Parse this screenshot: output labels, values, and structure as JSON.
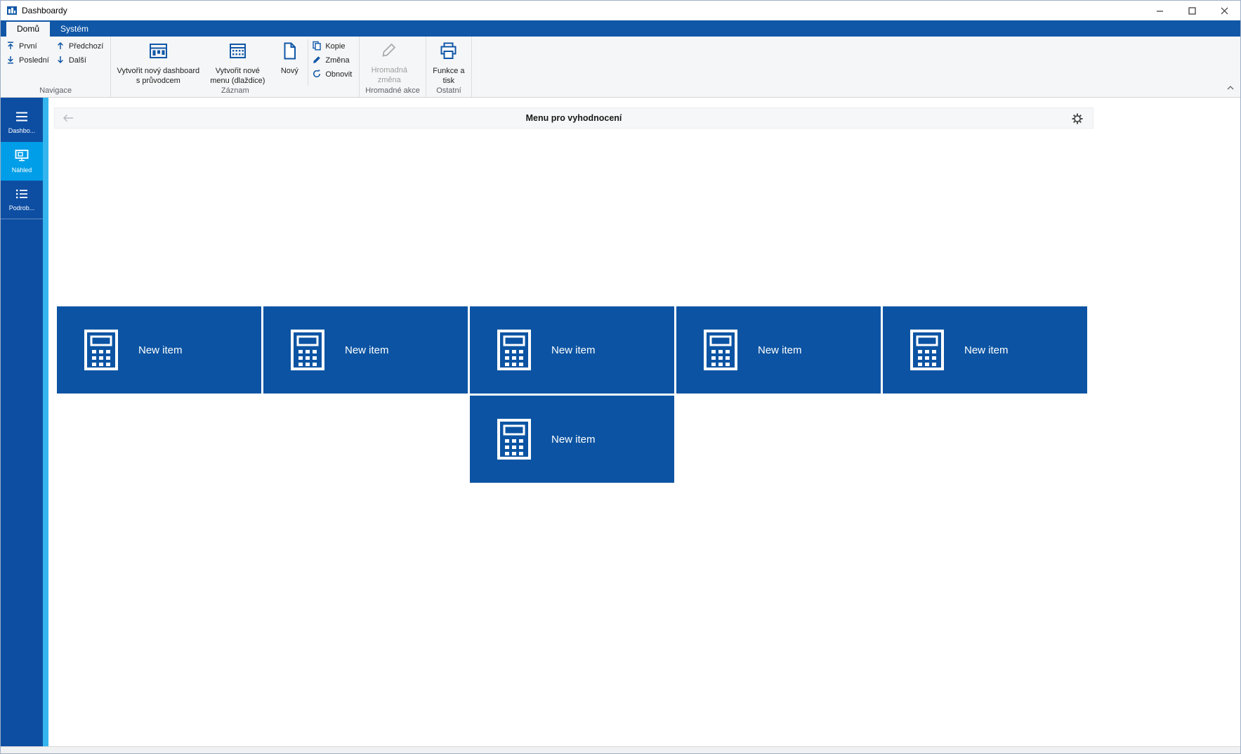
{
  "window": {
    "title": "Dashboardy"
  },
  "tabs": [
    {
      "label": "Domů",
      "active": true
    },
    {
      "label": "Systém",
      "active": false
    }
  ],
  "ribbon": {
    "groups": {
      "navigace": {
        "label": "Navigace"
      },
      "zaznam": {
        "label": "Záznam"
      },
      "hromadne_akce": {
        "label": "Hromadné akce"
      },
      "ostatni": {
        "label": "Ostatní"
      }
    },
    "buttons": {
      "prvni": "První",
      "posledni": "Poslední",
      "predchozi": "Předchozí",
      "dalsi": "Další",
      "vytvorit_dashboard": "Vytvořit nový dashboard s průvodcem",
      "vytvorit_menu": "Vytvořit nové menu (dlaždice)",
      "novy": "Nový",
      "kopie": "Kopie",
      "zmena": "Změna",
      "obnovit": "Obnovit",
      "hromadna_zmena": "Hromadná změna",
      "funkce_a_tisk": "Funkce a tisk"
    }
  },
  "sidebar": {
    "items": [
      {
        "label": "Dashbo...",
        "icon": "menu-icon",
        "active": false
      },
      {
        "label": "Náhled",
        "icon": "preview-monitor-icon",
        "active": true
      },
      {
        "label": "Podrob...",
        "icon": "detail-list-icon",
        "active": false
      }
    ]
  },
  "content": {
    "title": "Menu pro vyhodnocení",
    "tiles": [
      {
        "label": "New item",
        "icon": "calculator-icon"
      },
      {
        "label": "New item",
        "icon": "calculator-icon"
      },
      {
        "label": "New item",
        "icon": "calculator-icon"
      },
      {
        "label": "New item",
        "icon": "calculator-icon"
      },
      {
        "label": "New item",
        "icon": "calculator-icon"
      },
      {
        "label": "New item",
        "icon": "calculator-icon"
      }
    ]
  },
  "colors": {
    "ribbon_blue": "#1057a7",
    "sidebar_blue": "#0d4ea3",
    "active_item_cyan": "#009ee8",
    "accent_stripe": "#35b5ee",
    "tile_blue": "#0c54a3",
    "ribbon_background": "#f5f6f7"
  }
}
